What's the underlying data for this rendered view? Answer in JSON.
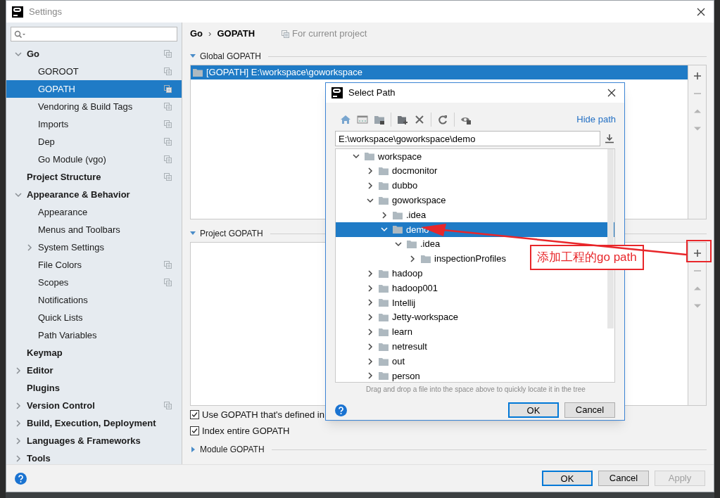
{
  "window": {
    "title": "Settings"
  },
  "sidebar": {
    "items": [
      {
        "label": "Go",
        "bold": true,
        "expanded": true,
        "selected": false,
        "project_scope": true,
        "children": [
          {
            "label": "GOROOT",
            "selected": false,
            "project_scope": true
          },
          {
            "label": "GOPATH",
            "selected": true,
            "project_scope": true
          },
          {
            "label": "Vendoring & Build Tags",
            "selected": false,
            "project_scope": true
          },
          {
            "label": "Imports",
            "selected": false,
            "project_scope": true
          },
          {
            "label": "Dep",
            "selected": false,
            "project_scope": true
          },
          {
            "label": "Go Module (vgo)",
            "selected": false,
            "project_scope": true
          }
        ]
      },
      {
        "label": "Project Structure",
        "bold": true,
        "selected": false,
        "project_scope": true
      },
      {
        "label": "Appearance & Behavior",
        "bold": true,
        "expanded": true,
        "selected": false,
        "project_scope": false,
        "children": [
          {
            "label": "Appearance",
            "selected": false,
            "project_scope": false
          },
          {
            "label": "Menus and Toolbars",
            "selected": false,
            "project_scope": false
          },
          {
            "label": "System Settings",
            "expanded": false,
            "selected": false,
            "project_scope": false
          },
          {
            "label": "File Colors",
            "selected": false,
            "project_scope": true
          },
          {
            "label": "Scopes",
            "selected": false,
            "project_scope": true
          },
          {
            "label": "Notifications",
            "selected": false,
            "project_scope": false
          },
          {
            "label": "Quick Lists",
            "selected": false,
            "project_scope": false
          },
          {
            "label": "Path Variables",
            "selected": false,
            "project_scope": false
          }
        ]
      },
      {
        "label": "Keymap",
        "bold": true,
        "selected": false,
        "project_scope": false
      },
      {
        "label": "Editor",
        "bold": true,
        "expanded": false,
        "selected": false,
        "project_scope": false
      },
      {
        "label": "Plugins",
        "bold": true,
        "selected": false,
        "project_scope": false
      },
      {
        "label": "Version Control",
        "bold": true,
        "expanded": false,
        "selected": false,
        "project_scope": true
      },
      {
        "label": "Build, Execution, Deployment",
        "bold": true,
        "expanded": false,
        "selected": false,
        "project_scope": false
      },
      {
        "label": "Languages & Frameworks",
        "bold": true,
        "expanded": false,
        "selected": false,
        "project_scope": false
      },
      {
        "label": "Tools",
        "bold": true,
        "expanded": false,
        "selected": false,
        "project_scope": false
      }
    ]
  },
  "breadcrumb": {
    "parts": [
      "Go",
      "›",
      "GOPATH"
    ],
    "scope_note": "For current project"
  },
  "global_gopath": {
    "title": "Global GOPATH",
    "expanded": true,
    "rows": [
      {
        "label": "[GOPATH] E:\\workspace\\goworkspace",
        "selected": true
      }
    ],
    "tools": [
      {
        "kind": "add",
        "disabled": false
      },
      {
        "kind": "remove",
        "disabled": true
      },
      {
        "kind": "up",
        "disabled": true
      },
      {
        "kind": "down",
        "disabled": true
      }
    ]
  },
  "project_gopath": {
    "title": "Project GOPATH",
    "expanded": true,
    "tools": [
      {
        "kind": "add",
        "disabled": false
      },
      {
        "kind": "remove",
        "disabled": true
      },
      {
        "kind": "up",
        "disabled": true
      },
      {
        "kind": "down",
        "disabled": true
      }
    ]
  },
  "options": [
    {
      "label": "Use GOPATH that's defined in",
      "checked": true
    },
    {
      "label": "Index entire GOPATH",
      "checked": true
    }
  ],
  "module_gopath": {
    "title": "Module GOPATH",
    "expanded": false
  },
  "buttons": [
    {
      "label": "OK",
      "default": true,
      "disabled": false
    },
    {
      "label": "Cancel",
      "default": false,
      "disabled": false
    },
    {
      "label": "Apply",
      "default": false,
      "disabled": true
    }
  ],
  "dialog": {
    "title": "Select Path",
    "hide_path": "Hide path",
    "path": "E:\\workspace\\goworkspace\\demo",
    "tree": [
      {
        "label": "workspace",
        "expanded": true,
        "selected": false,
        "children": [
          {
            "label": "docmonitor",
            "expanded": false,
            "selected": false
          },
          {
            "label": "dubbo",
            "expanded": false,
            "selected": false
          },
          {
            "label": "goworkspace",
            "expanded": true,
            "selected": false,
            "children": [
              {
                "label": ".idea",
                "expanded": false,
                "selected": false
              },
              {
                "label": "demo",
                "expanded": true,
                "selected": true,
                "children": [
                  {
                    "label": ".idea",
                    "expanded": true,
                    "selected": false,
                    "children": [
                      {
                        "label": "inspectionProfiles",
                        "expanded": false,
                        "selected": false
                      }
                    ]
                  }
                ]
              }
            ]
          },
          {
            "label": "hadoop",
            "expanded": false,
            "selected": false
          },
          {
            "label": "hadoop001",
            "expanded": false,
            "selected": false
          },
          {
            "label": "Intellij",
            "expanded": false,
            "selected": false
          },
          {
            "label": "Jetty-workspace",
            "expanded": false,
            "selected": false
          },
          {
            "label": "learn",
            "expanded": false,
            "selected": false
          },
          {
            "label": "netresult",
            "expanded": false,
            "selected": false
          },
          {
            "label": "out",
            "expanded": false,
            "selected": false
          },
          {
            "label": "person",
            "expanded": false,
            "selected": false
          }
        ]
      }
    ],
    "hint": "Drag and drop a file into the space above to quickly locate it in the tree",
    "buttons": [
      {
        "label": "OK",
        "default": true
      },
      {
        "label": "Cancel",
        "default": false
      }
    ]
  },
  "annotation": {
    "label": "添加工程的go path"
  }
}
